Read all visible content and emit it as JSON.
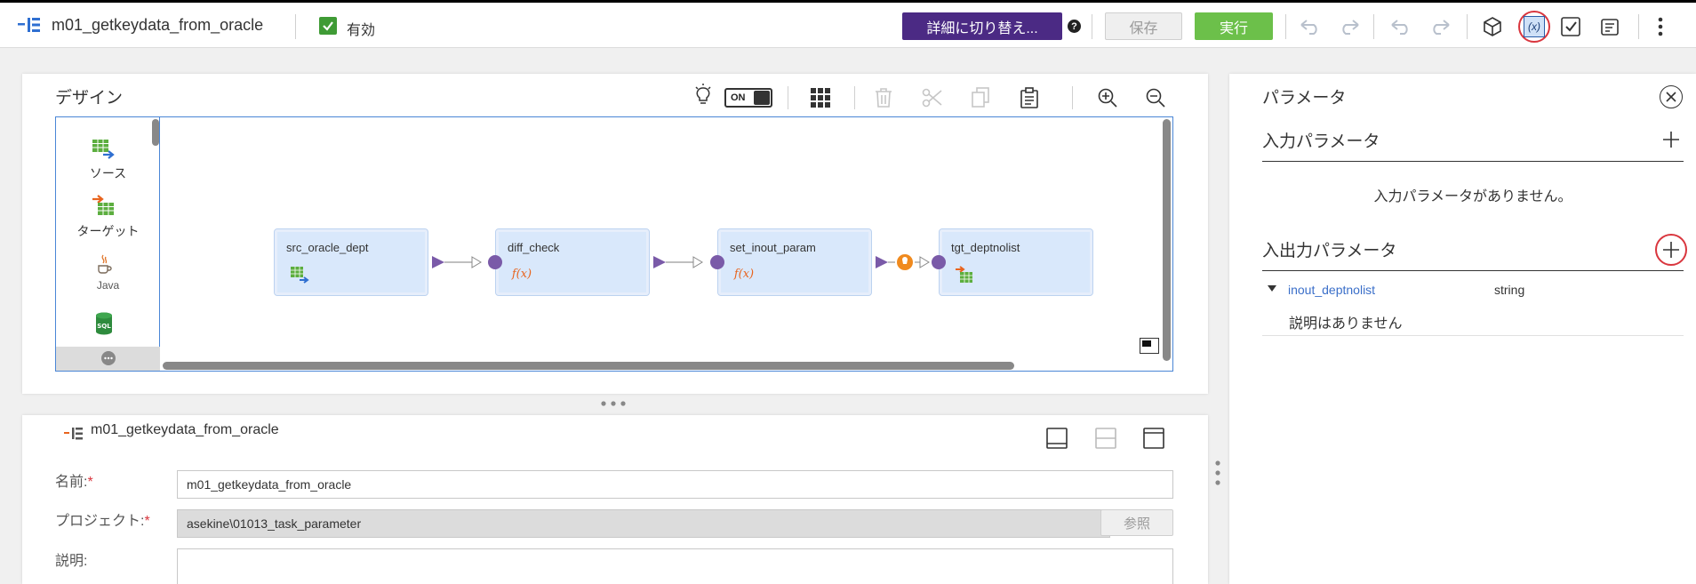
{
  "header": {
    "mapping_name": "m01_getkeydata_from_oracle",
    "valid_label": "有効",
    "switch_details_label": "詳細に切り替え...",
    "save_label": "保存",
    "run_label": "実行"
  },
  "design": {
    "title": "デザイン",
    "toggle_label": "ON",
    "palette": [
      {
        "label": "ソース",
        "icon": "source-icon"
      },
      {
        "label": "ターゲット",
        "icon": "target-icon"
      },
      {
        "label": "Java",
        "icon": "java-icon"
      },
      {
        "label": "SQL",
        "icon": "sql-icon"
      }
    ],
    "nodes": [
      {
        "label": "src_oracle_dept",
        "icon": "source-table-icon"
      },
      {
        "label": "diff_check",
        "icon": "expression-icon"
      },
      {
        "label": "set_inout_param",
        "icon": "expression-icon"
      },
      {
        "label": "tgt_deptnolist",
        "icon": "target-table-icon"
      }
    ],
    "expression_glyph": "f(x)"
  },
  "properties": {
    "title": "m01_getkeydata_from_oracle",
    "name_label": "名前:",
    "name_value": "m01_getkeydata_from_oracle",
    "project_label": "プロジェクト:",
    "project_value": "asekine\\01013_task_parameter",
    "browse_label": "参照",
    "description_label": "説明:",
    "required_mark": "*"
  },
  "parameters": {
    "title": "パラメータ",
    "input_section": "入力パラメータ",
    "input_empty": "入力パラメータがありません。",
    "inout_section": "入出力パラメータ",
    "items": [
      {
        "name": "inout_deptnolist",
        "type": "string",
        "description": "説明はありません"
      }
    ]
  },
  "colors": {
    "accent_purple": "#4b2a84",
    "run_green": "#6cc04a",
    "node_fill": "#d9e8fb",
    "port_purple": "#7a5aa8",
    "highlight_red": "#d9363e",
    "link_blue": "#3b6fc9"
  }
}
